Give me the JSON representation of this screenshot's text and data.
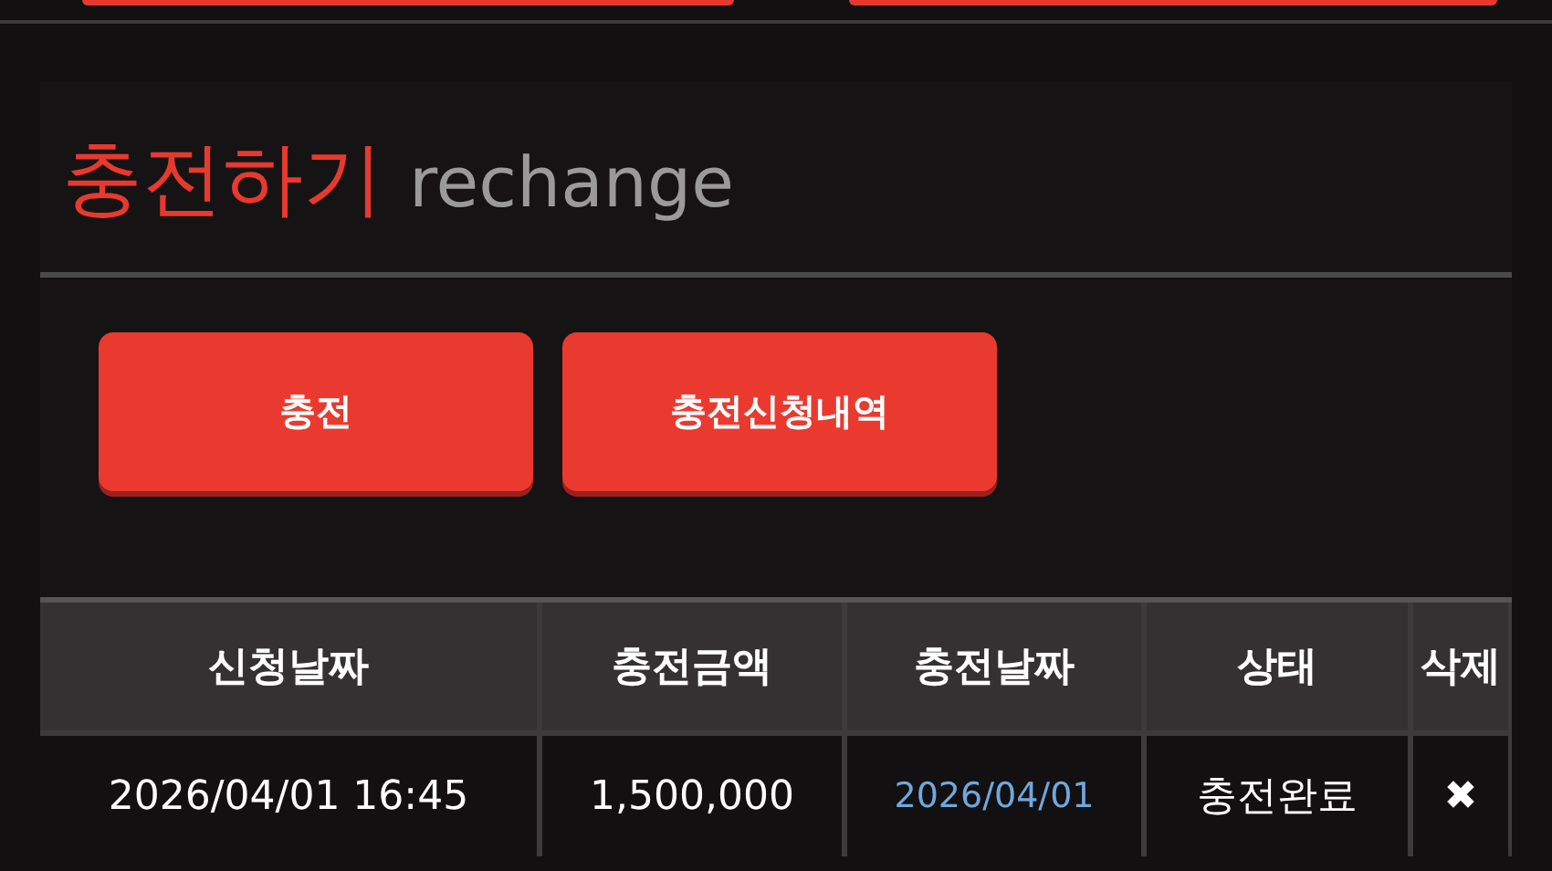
{
  "heading": {
    "title": "충전하기",
    "subtitle": "rechange"
  },
  "actions": [
    {
      "label": "충전"
    },
    {
      "label": "충전신청내역"
    }
  ],
  "table": {
    "columns": [
      "신청날짜",
      "충전금액",
      "충전날짜",
      "상태",
      "삭제"
    ],
    "rows": [
      {
        "request_date": "2026/04/01 16:45",
        "amount": "1,500,000",
        "charge_date": "2026/04/01",
        "status": "충전완료",
        "delete": "✖"
      }
    ]
  }
}
